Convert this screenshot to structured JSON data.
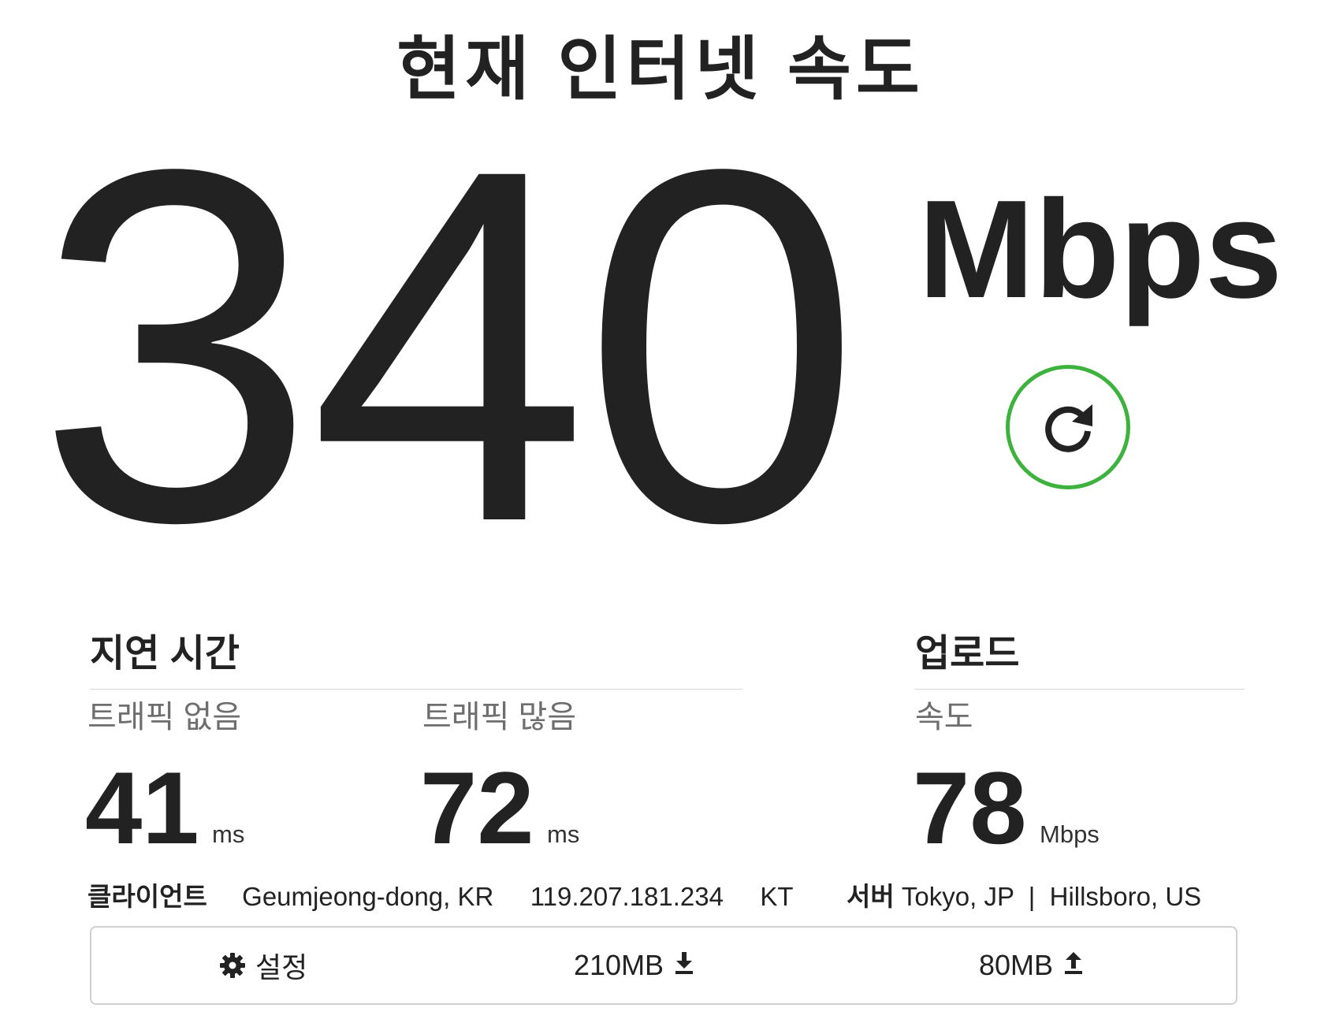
{
  "header": {
    "title": "현재 인터넷 속도"
  },
  "download": {
    "value": "340",
    "unit": "Mbps"
  },
  "latency": {
    "title": "지연 시간",
    "unloaded": {
      "label": "트래픽 없음",
      "value": "41",
      "unit": "ms"
    },
    "loaded": {
      "label": "트래픽 많음",
      "value": "72",
      "unit": "ms"
    }
  },
  "upload": {
    "title": "업로드",
    "label": "속도",
    "value": "78",
    "unit": "Mbps"
  },
  "client": {
    "label": "클라이언트",
    "location": "Geumjeong-dong, KR",
    "ip": "119.207.181.234",
    "isp": "KT"
  },
  "server": {
    "label": "서버",
    "locations": "Tokyo, JP  |  Hillsboro, US"
  },
  "footer": {
    "settings_label": "설정",
    "download_data": "210MB",
    "upload_data": "80MB"
  },
  "icons": {
    "refresh": "refresh-icon",
    "settings": "gear-icon",
    "download": "download-arrow-icon",
    "upload": "upload-arrow-icon"
  },
  "colors": {
    "accent": "#3db23d",
    "text": "#222222",
    "muted": "#6e6e6e",
    "border": "#d0d0d0"
  }
}
